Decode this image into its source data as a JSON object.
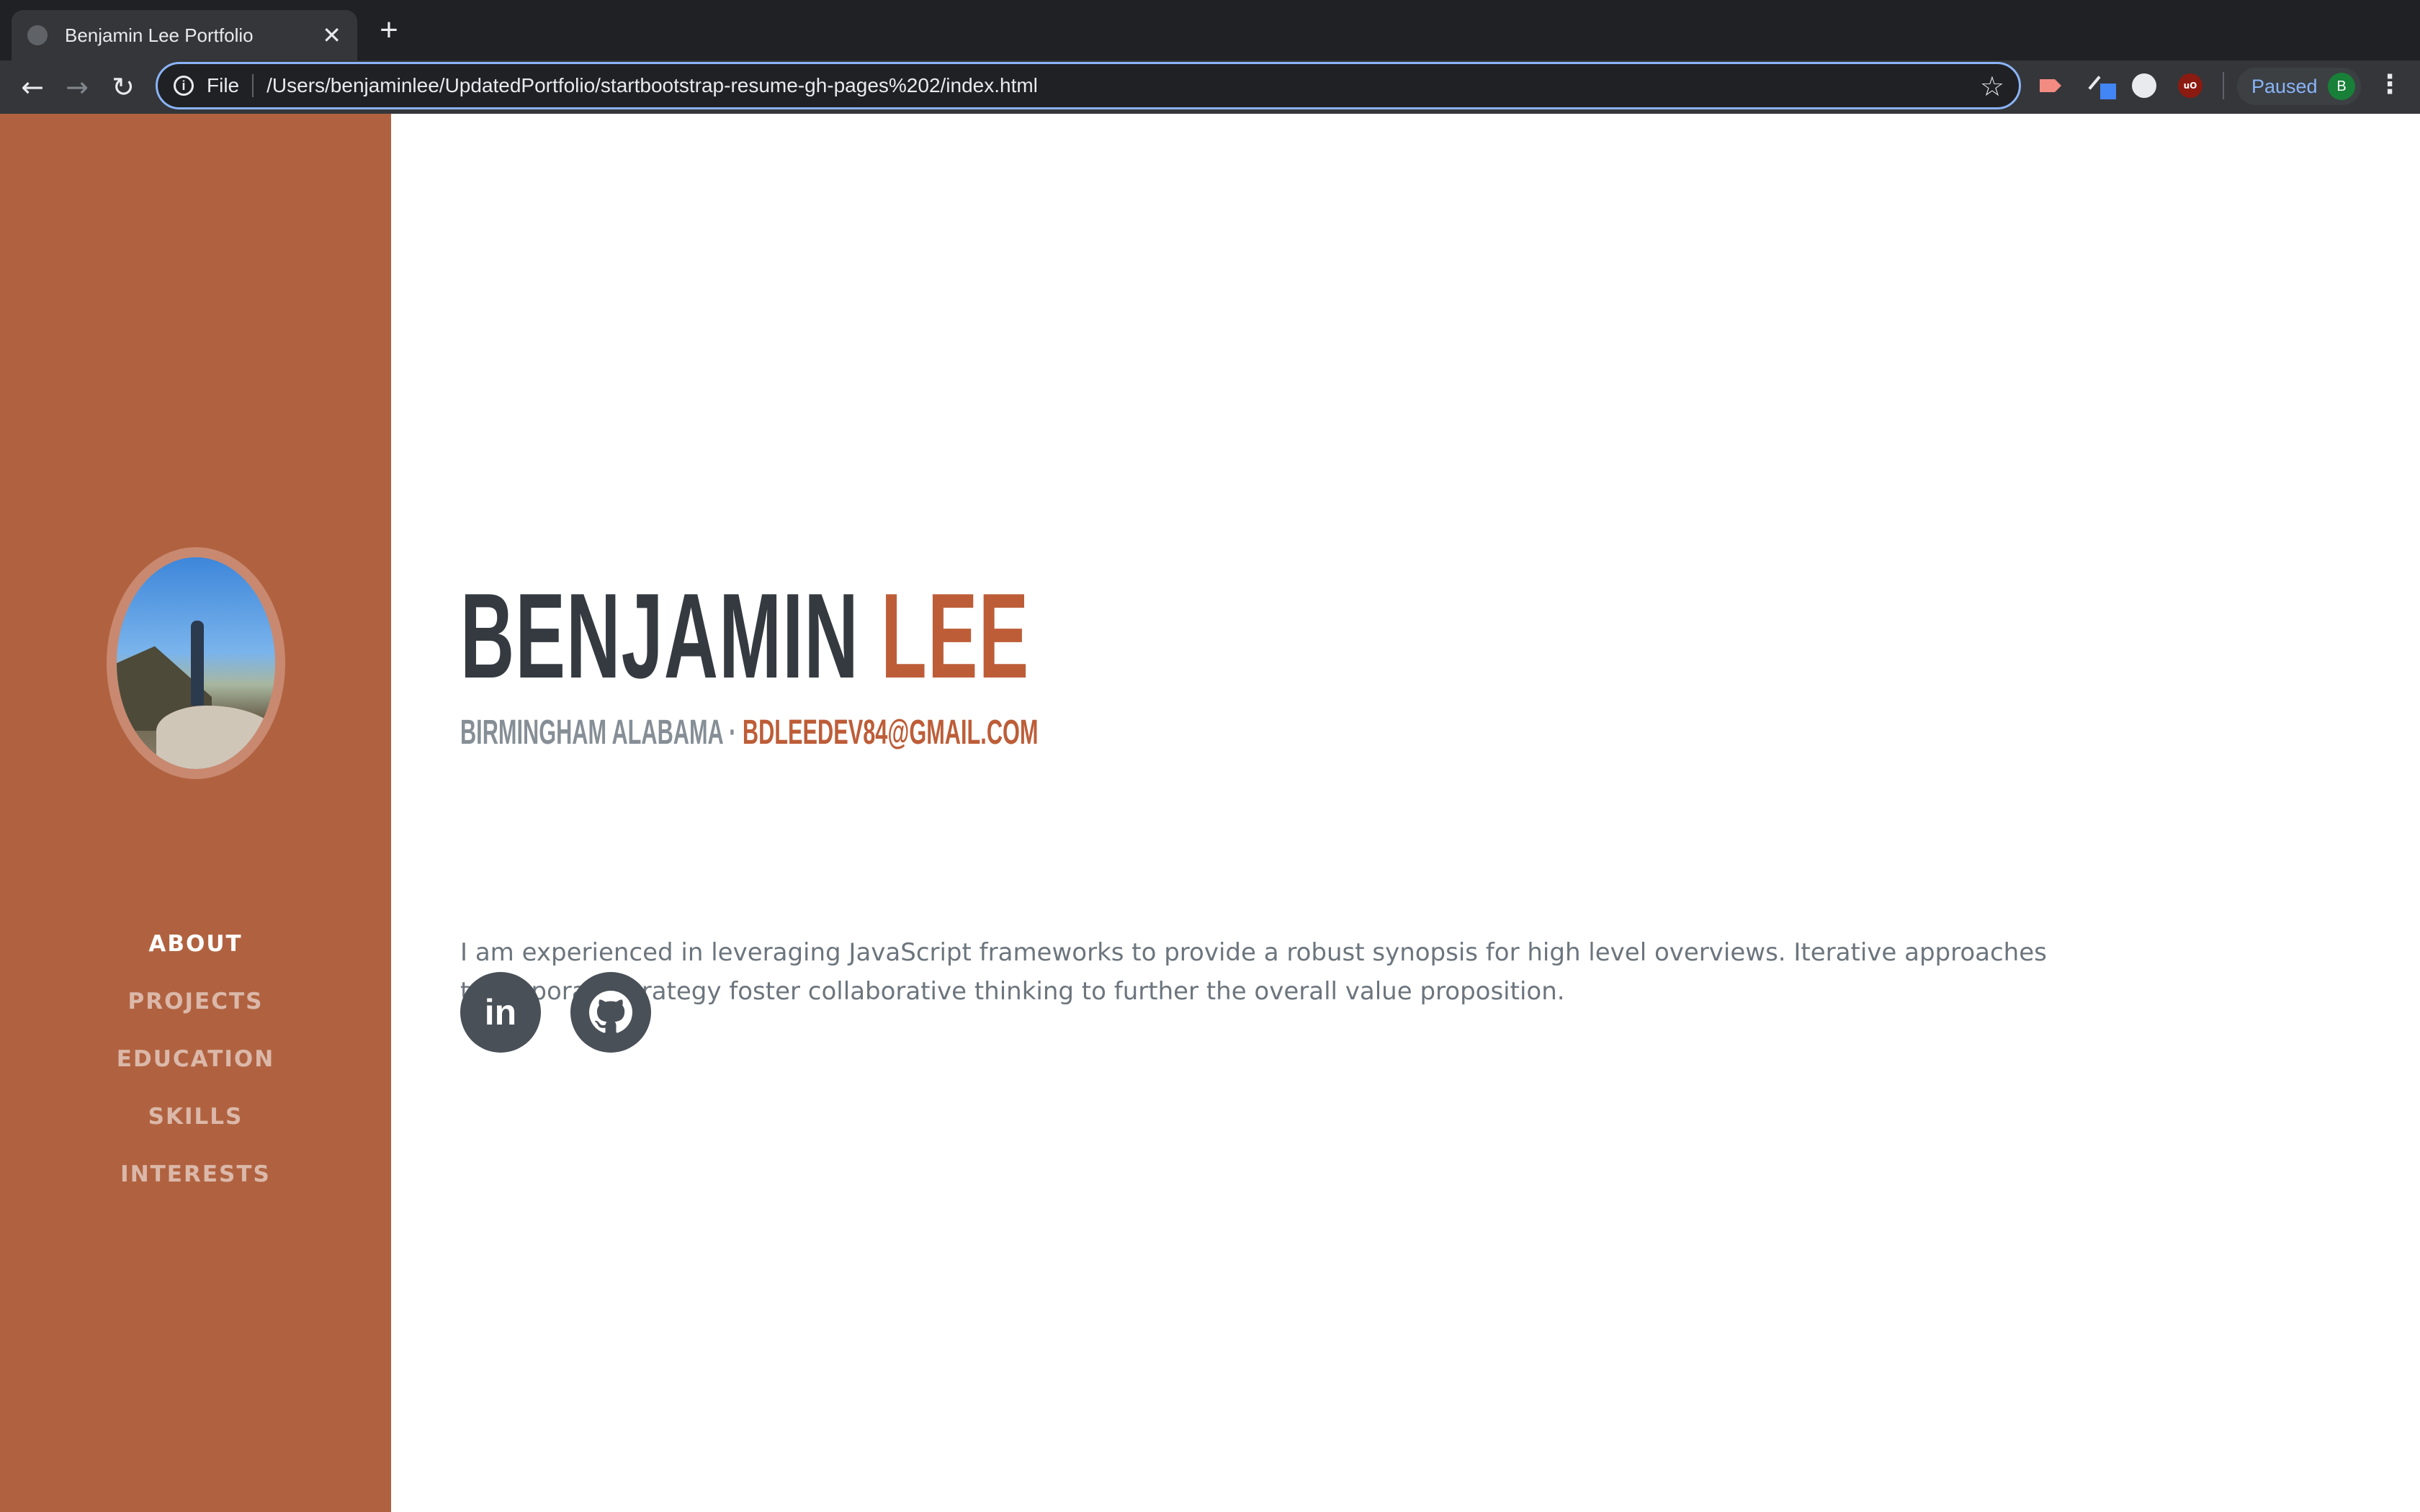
{
  "browser": {
    "tab_title": "Benjamin Lee Portfolio",
    "tab_close": "✕",
    "new_tab": "+",
    "scheme_label": "File",
    "url": "/Users/benjaminlee/UpdatedPortfolio/startbootstrap-resume-gh-pages%202/index.html",
    "info_glyph": "i",
    "profile_status": "Paused",
    "profile_initial": "B",
    "back_glyph": "←",
    "forward_glyph": "→",
    "reload_glyph": "↻",
    "star_glyph": "☆",
    "menu_glyph": "⋮",
    "omnibox_focus_color": "#8ab4f8"
  },
  "sidebar": {
    "background": "#b06240",
    "nav": [
      {
        "label": "ABOUT",
        "active": true
      },
      {
        "label": "PROJECTS",
        "active": false
      },
      {
        "label": "EDUCATION",
        "active": false
      },
      {
        "label": "SKILLS",
        "active": false
      },
      {
        "label": "INTERESTS",
        "active": false
      }
    ]
  },
  "main": {
    "first_name": "BENJAMIN",
    "last_name": "LEE",
    "location": "BIRMINGHAM ALABAMA ·",
    "email": "BDLEEDEV84@GMAIL.COM",
    "lead": "I am experienced in leveraging JavaScript frameworks to provide a robust synopsis for high level overviews. Iterative approaches to corporate strategy foster collaborative thinking to further the overall value proposition.",
    "social": [
      {
        "icon": "linkedin-icon",
        "label": "in"
      },
      {
        "icon": "github-icon"
      }
    ],
    "accent_color": "#bd5d38",
    "heading_color": "#343a40"
  }
}
